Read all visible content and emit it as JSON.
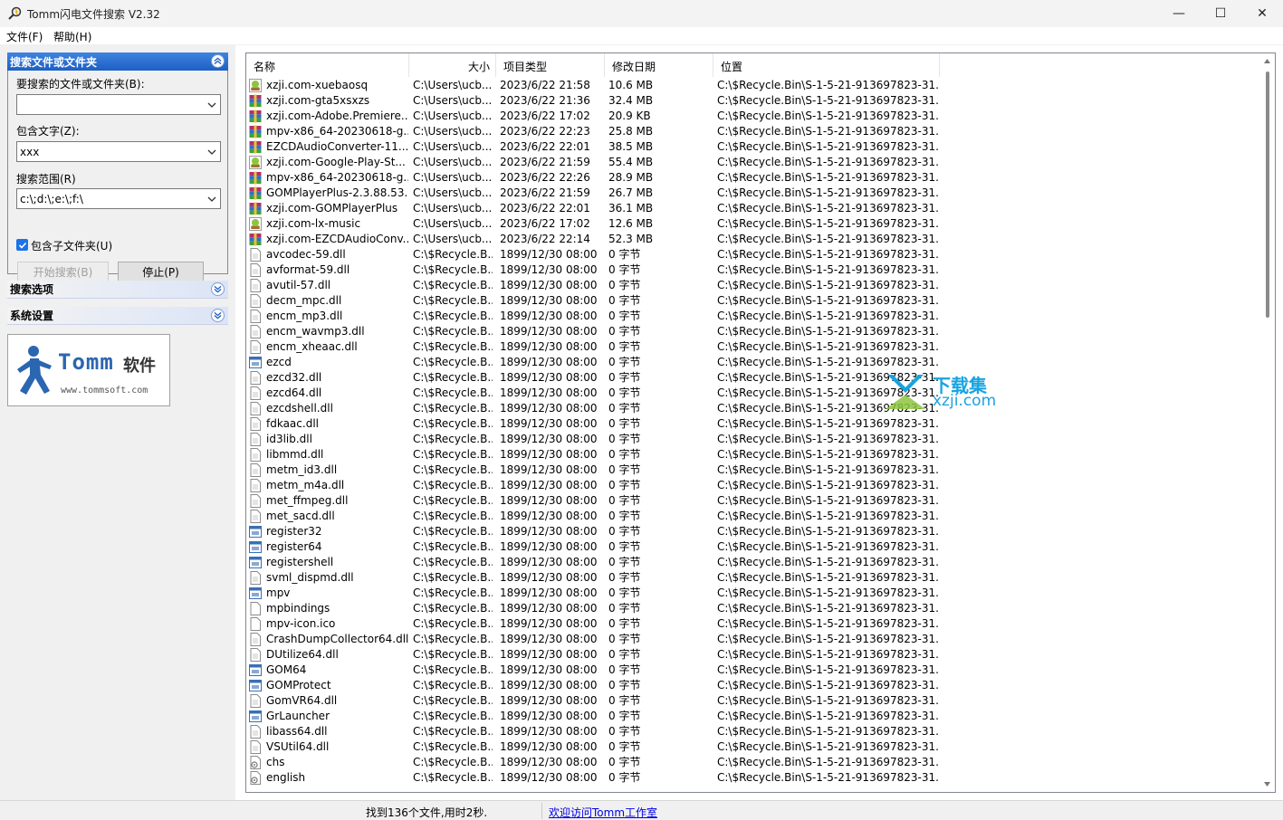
{
  "window": {
    "title": "Tomm闪电文件搜索 V2.32",
    "minimize": "—",
    "maximize": "☐",
    "close": "✕"
  },
  "menu": [
    "文件(F)",
    "帮助(H)"
  ],
  "left_panel": {
    "search_group_title": "搜索文件或文件夹",
    "file_label": "要搜索的文件或文件夹(B):",
    "file_value": "",
    "contains_label": "包含文字(Z):",
    "contains_value": "xxx",
    "scope_label": "搜索范围(R)",
    "scope_value": "c:\\;d:\\;e:\\;f:\\",
    "include_subfolders_label": "包含子文件夹(U)",
    "include_subfolders_checked": true,
    "start_button": "开始搜索(B)",
    "stop_button": "停止(P)",
    "options_group_title": "搜索选项",
    "settings_group_title": "系统设置",
    "logo_brand": "Tomm",
    "logo_cn": "软件",
    "logo_url": "www.tommsoft.com"
  },
  "list": {
    "columns": [
      "名称",
      "大小",
      "项目类型",
      "修改日期",
      "位置"
    ],
    "rows": [
      {
        "icon": "android-apk-icon",
        "name": "xzji.com-xuebaosq",
        "dir": "C:\\Users\\ucb...",
        "date": "2023/6/22 21:58",
        "size": "10.6 MB",
        "loc": "C:\\$Recycle.Bin\\S-1-5-21-913697823-31..."
      },
      {
        "icon": "winrar-archive-icon",
        "name": "xzji.com-gta5xsxzs",
        "dir": "C:\\Users\\ucb...",
        "date": "2023/6/22 21:36",
        "size": "32.4 MB",
        "loc": "C:\\$Recycle.Bin\\S-1-5-21-913697823-31..."
      },
      {
        "icon": "winrar-archive-icon",
        "name": "xzji.com-Adobe.Premiere...",
        "dir": "C:\\Users\\ucb...",
        "date": "2023/6/22 17:02",
        "size": "20.9 KB",
        "loc": "C:\\$Recycle.Bin\\S-1-5-21-913697823-31..."
      },
      {
        "icon": "winrar-archive-icon",
        "name": "mpv-x86_64-20230618-g...",
        "dir": "C:\\Users\\ucb...",
        "date": "2023/6/22 22:23",
        "size": "25.8 MB",
        "loc": "C:\\$Recycle.Bin\\S-1-5-21-913697823-31..."
      },
      {
        "icon": "winrar-archive-icon",
        "name": "EZCDAudioConverter-11....",
        "dir": "C:\\Users\\ucb...",
        "date": "2023/6/22 22:01",
        "size": "38.5 MB",
        "loc": "C:\\$Recycle.Bin\\S-1-5-21-913697823-31..."
      },
      {
        "icon": "android-apk-icon",
        "name": "xzji.com-Google-Play-St...",
        "dir": "C:\\Users\\ucb...",
        "date": "2023/6/22 21:59",
        "size": "55.4 MB",
        "loc": "C:\\$Recycle.Bin\\S-1-5-21-913697823-31..."
      },
      {
        "icon": "winrar-archive-icon",
        "name": "mpv-x86_64-20230618-g...",
        "dir": "C:\\Users\\ucb...",
        "date": "2023/6/22 22:26",
        "size": "28.9 MB",
        "loc": "C:\\$Recycle.Bin\\S-1-5-21-913697823-31..."
      },
      {
        "icon": "winrar-archive-icon",
        "name": "GOMPlayerPlus-2.3.88.53...",
        "dir": "C:\\Users\\ucb...",
        "date": "2023/6/22 21:59",
        "size": "26.7 MB",
        "loc": "C:\\$Recycle.Bin\\S-1-5-21-913697823-31..."
      },
      {
        "icon": "winrar-archive-icon",
        "name": "xzji.com-GOMPlayerPlus",
        "dir": "C:\\Users\\ucb...",
        "date": "2023/6/22 22:01",
        "size": "36.1 MB",
        "loc": "C:\\$Recycle.Bin\\S-1-5-21-913697823-31..."
      },
      {
        "icon": "android-apk-icon",
        "name": "xzji.com-lx-music",
        "dir": "C:\\Users\\ucb...",
        "date": "2023/6/22 17:02",
        "size": "12.6 MB",
        "loc": "C:\\$Recycle.Bin\\S-1-5-21-913697823-31..."
      },
      {
        "icon": "winrar-archive-icon",
        "name": "xzji.com-EZCDAudioConv...",
        "dir": "C:\\Users\\ucb...",
        "date": "2023/6/22 22:14",
        "size": "52.3 MB",
        "loc": "C:\\$Recycle.Bin\\S-1-5-21-913697823-31..."
      },
      {
        "icon": "file-icon",
        "name": "avcodec-59.dll",
        "dir": "C:\\$Recycle.B...",
        "date": "1899/12/30 08:00",
        "size": "0 字节",
        "loc": "C:\\$Recycle.Bin\\S-1-5-21-913697823-31..."
      },
      {
        "icon": "file-icon",
        "name": "avformat-59.dll",
        "dir": "C:\\$Recycle.B...",
        "date": "1899/12/30 08:00",
        "size": "0 字节",
        "loc": "C:\\$Recycle.Bin\\S-1-5-21-913697823-31..."
      },
      {
        "icon": "file-icon",
        "name": "avutil-57.dll",
        "dir": "C:\\$Recycle.B...",
        "date": "1899/12/30 08:00",
        "size": "0 字节",
        "loc": "C:\\$Recycle.Bin\\S-1-5-21-913697823-31..."
      },
      {
        "icon": "file-icon",
        "name": "decm_mpc.dll",
        "dir": "C:\\$Recycle.B...",
        "date": "1899/12/30 08:00",
        "size": "0 字节",
        "loc": "C:\\$Recycle.Bin\\S-1-5-21-913697823-31..."
      },
      {
        "icon": "file-icon",
        "name": "encm_mp3.dll",
        "dir": "C:\\$Recycle.B...",
        "date": "1899/12/30 08:00",
        "size": "0 字节",
        "loc": "C:\\$Recycle.Bin\\S-1-5-21-913697823-31..."
      },
      {
        "icon": "file-icon",
        "name": "encm_wavmp3.dll",
        "dir": "C:\\$Recycle.B...",
        "date": "1899/12/30 08:00",
        "size": "0 字节",
        "loc": "C:\\$Recycle.Bin\\S-1-5-21-913697823-31..."
      },
      {
        "icon": "file-icon",
        "name": "encm_xheaac.dll",
        "dir": "C:\\$Recycle.B...",
        "date": "1899/12/30 08:00",
        "size": "0 字节",
        "loc": "C:\\$Recycle.Bin\\S-1-5-21-913697823-31..."
      },
      {
        "icon": "executable-icon",
        "name": "ezcd",
        "dir": "C:\\$Recycle.B...",
        "date": "1899/12/30 08:00",
        "size": "0 字节",
        "loc": "C:\\$Recycle.Bin\\S-1-5-21-913697823-31..."
      },
      {
        "icon": "file-icon",
        "name": "ezcd32.dll",
        "dir": "C:\\$Recycle.B...",
        "date": "1899/12/30 08:00",
        "size": "0 字节",
        "loc": "C:\\$Recycle.Bin\\S-1-5-21-913697823-31..."
      },
      {
        "icon": "file-icon",
        "name": "ezcd64.dll",
        "dir": "C:\\$Recycle.B...",
        "date": "1899/12/30 08:00",
        "size": "0 字节",
        "loc": "C:\\$Recycle.Bin\\S-1-5-21-913697823-31..."
      },
      {
        "icon": "file-icon",
        "name": "ezcdshell.dll",
        "dir": "C:\\$Recycle.B...",
        "date": "1899/12/30 08:00",
        "size": "0 字节",
        "loc": "C:\\$Recycle.Bin\\S-1-5-21-913697823-31..."
      },
      {
        "icon": "file-icon",
        "name": "fdkaac.dll",
        "dir": "C:\\$Recycle.B...",
        "date": "1899/12/30 08:00",
        "size": "0 字节",
        "loc": "C:\\$Recycle.Bin\\S-1-5-21-913697823-31..."
      },
      {
        "icon": "file-icon",
        "name": "id3lib.dll",
        "dir": "C:\\$Recycle.B...",
        "date": "1899/12/30 08:00",
        "size": "0 字节",
        "loc": "C:\\$Recycle.Bin\\S-1-5-21-913697823-31..."
      },
      {
        "icon": "file-icon",
        "name": "libmmd.dll",
        "dir": "C:\\$Recycle.B...",
        "date": "1899/12/30 08:00",
        "size": "0 字节",
        "loc": "C:\\$Recycle.Bin\\S-1-5-21-913697823-31..."
      },
      {
        "icon": "file-icon",
        "name": "metm_id3.dll",
        "dir": "C:\\$Recycle.B...",
        "date": "1899/12/30 08:00",
        "size": "0 字节",
        "loc": "C:\\$Recycle.Bin\\S-1-5-21-913697823-31..."
      },
      {
        "icon": "file-icon",
        "name": "metm_m4a.dll",
        "dir": "C:\\$Recycle.B...",
        "date": "1899/12/30 08:00",
        "size": "0 字节",
        "loc": "C:\\$Recycle.Bin\\S-1-5-21-913697823-31..."
      },
      {
        "icon": "file-icon",
        "name": "met_ffmpeg.dll",
        "dir": "C:\\$Recycle.B...",
        "date": "1899/12/30 08:00",
        "size": "0 字节",
        "loc": "C:\\$Recycle.Bin\\S-1-5-21-913697823-31..."
      },
      {
        "icon": "file-icon",
        "name": "met_sacd.dll",
        "dir": "C:\\$Recycle.B...",
        "date": "1899/12/30 08:00",
        "size": "0 字节",
        "loc": "C:\\$Recycle.Bin\\S-1-5-21-913697823-31..."
      },
      {
        "icon": "executable-icon",
        "name": "register32",
        "dir": "C:\\$Recycle.B...",
        "date": "1899/12/30 08:00",
        "size": "0 字节",
        "loc": "C:\\$Recycle.Bin\\S-1-5-21-913697823-31..."
      },
      {
        "icon": "executable-icon",
        "name": "register64",
        "dir": "C:\\$Recycle.B...",
        "date": "1899/12/30 08:00",
        "size": "0 字节",
        "loc": "C:\\$Recycle.Bin\\S-1-5-21-913697823-31..."
      },
      {
        "icon": "executable-icon",
        "name": "registershell",
        "dir": "C:\\$Recycle.B...",
        "date": "1899/12/30 08:00",
        "size": "0 字节",
        "loc": "C:\\$Recycle.Bin\\S-1-5-21-913697823-31..."
      },
      {
        "icon": "file-icon",
        "name": "svml_dispmd.dll",
        "dir": "C:\\$Recycle.B...",
        "date": "1899/12/30 08:00",
        "size": "0 字节",
        "loc": "C:\\$Recycle.Bin\\S-1-5-21-913697823-31..."
      },
      {
        "icon": "executable-icon",
        "name": "mpv",
        "dir": "C:\\$Recycle.B...",
        "date": "1899/12/30 08:00",
        "size": "0 字节",
        "loc": "C:\\$Recycle.Bin\\S-1-5-21-913697823-31..."
      },
      {
        "icon": "blank-file-icon",
        "name": "mpbindings",
        "dir": "C:\\$Recycle.B...",
        "date": "1899/12/30 08:00",
        "size": "0 字节",
        "loc": "C:\\$Recycle.Bin\\S-1-5-21-913697823-31..."
      },
      {
        "icon": "blank-file-icon",
        "name": "mpv-icon.ico",
        "dir": "C:\\$Recycle.B...",
        "date": "1899/12/30 08:00",
        "size": "0 字节",
        "loc": "C:\\$Recycle.Bin\\S-1-5-21-913697823-31..."
      },
      {
        "icon": "file-icon",
        "name": "CrashDumpCollector64.dll",
        "dir": "C:\\$Recycle.B...",
        "date": "1899/12/30 08:00",
        "size": "0 字节",
        "loc": "C:\\$Recycle.Bin\\S-1-5-21-913697823-31..."
      },
      {
        "icon": "file-icon",
        "name": "DUtilize64.dll",
        "dir": "C:\\$Recycle.B...",
        "date": "1899/12/30 08:00",
        "size": "0 字节",
        "loc": "C:\\$Recycle.Bin\\S-1-5-21-913697823-31..."
      },
      {
        "icon": "executable-icon",
        "name": "GOM64",
        "dir": "C:\\$Recycle.B...",
        "date": "1899/12/30 08:00",
        "size": "0 字节",
        "loc": "C:\\$Recycle.Bin\\S-1-5-21-913697823-31..."
      },
      {
        "icon": "executable-icon",
        "name": "GOMProtect",
        "dir": "C:\\$Recycle.B...",
        "date": "1899/12/30 08:00",
        "size": "0 字节",
        "loc": "C:\\$Recycle.Bin\\S-1-5-21-913697823-31..."
      },
      {
        "icon": "file-icon",
        "name": "GomVR64.dll",
        "dir": "C:\\$Recycle.B...",
        "date": "1899/12/30 08:00",
        "size": "0 字节",
        "loc": "C:\\$Recycle.Bin\\S-1-5-21-913697823-31..."
      },
      {
        "icon": "executable-icon",
        "name": "GrLauncher",
        "dir": "C:\\$Recycle.B...",
        "date": "1899/12/30 08:00",
        "size": "0 字节",
        "loc": "C:\\$Recycle.Bin\\S-1-5-21-913697823-31..."
      },
      {
        "icon": "file-icon",
        "name": "libass64.dll",
        "dir": "C:\\$Recycle.B...",
        "date": "1899/12/30 08:00",
        "size": "0 字节",
        "loc": "C:\\$Recycle.Bin\\S-1-5-21-913697823-31..."
      },
      {
        "icon": "file-icon",
        "name": "VSUtil64.dll",
        "dir": "C:\\$Recycle.B...",
        "date": "1899/12/30 08:00",
        "size": "0 字节",
        "loc": "C:\\$Recycle.Bin\\S-1-5-21-913697823-31..."
      },
      {
        "icon": "settings-file-icon",
        "name": "chs",
        "dir": "C:\\$Recycle.B...",
        "date": "1899/12/30 08:00",
        "size": "0 字节",
        "loc": "C:\\$Recycle.Bin\\S-1-5-21-913697823-31..."
      },
      {
        "icon": "settings-file-icon",
        "name": "english",
        "dir": "C:\\$Recycle.B...",
        "date": "1899/12/30 08:00",
        "size": "0 字节",
        "loc": "C:\\$Recycle.Bin\\S-1-5-21-913697823-31..."
      }
    ]
  },
  "status": {
    "text": "找到136个文件,用时2秒.",
    "link": "欢迎访问Tomm工作室"
  },
  "watermark": {
    "cn": "下载集",
    "url": "xzji.com"
  },
  "colors": {
    "accent": "#1d5fc4",
    "link": "#0000ee",
    "watermark": "#1aa3e0"
  }
}
